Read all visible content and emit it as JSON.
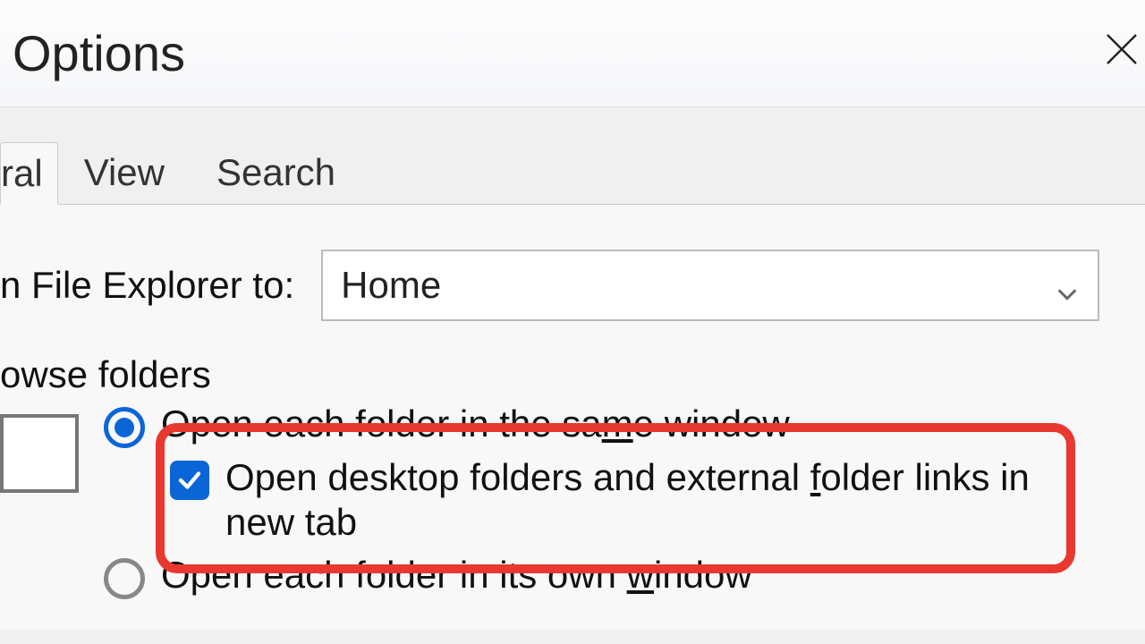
{
  "window": {
    "title": "Options"
  },
  "tabs": {
    "general": "ral",
    "view": "View",
    "search": "Search"
  },
  "open_to": {
    "label": "n File Explorer to:",
    "selected": "Home"
  },
  "browse_group": {
    "label": "owse folders",
    "radio1_pre": "Open each folder in the sa",
    "radio1_u": "m",
    "radio1_post": "e window",
    "checkbox_pre": "Open desktop folders and external ",
    "checkbox_u": "f",
    "checkbox_post": "older links in new tab",
    "radio2_pre": "Open each folder in its own ",
    "radio2_u": "w",
    "radio2_post": "indow"
  }
}
